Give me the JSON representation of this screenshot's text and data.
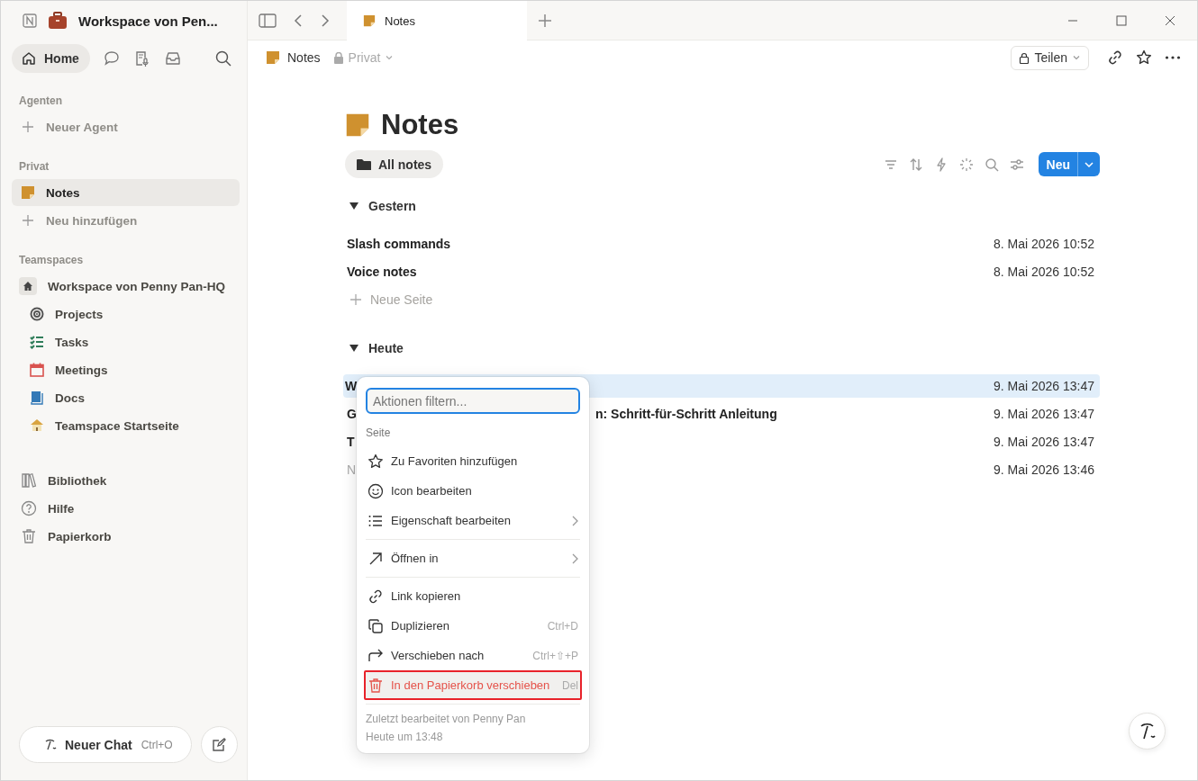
{
  "sidebar": {
    "workspace": "Workspace von Pen...",
    "home": {
      "label": "Home",
      "selected": true
    },
    "agents": {
      "heading": "Agenten",
      "add": "Neuer Agent"
    },
    "private": {
      "heading": "Privat",
      "items": [
        {
          "label": "Notes",
          "selected": true
        }
      ],
      "add": "Neu hinzufügen"
    },
    "teamspaces": {
      "heading": "Teamspaces",
      "workspace": "Workspace von Penny Pan-HQ",
      "items": [
        {
          "label": "Projects",
          "color": "#555555"
        },
        {
          "label": "Tasks",
          "color": "#2f7d5a"
        },
        {
          "label": "Meetings",
          "color": "#d9534f"
        },
        {
          "label": "Docs",
          "color": "#337ab7"
        },
        {
          "label": "Teamspace Startseite",
          "color": "#d9a441"
        }
      ]
    },
    "footer_items": [
      {
        "label": "Bibliothek"
      },
      {
        "label": "Hilfe"
      },
      {
        "label": "Papierkorb"
      }
    ],
    "chat": {
      "label": "Neuer Chat",
      "shortcut": "Ctrl+O"
    }
  },
  "tabs": [
    {
      "label": "Notes",
      "selected": true
    }
  ],
  "breadcrumb": {
    "page": "Notes",
    "privacy": "Privat"
  },
  "share": "Teilen",
  "page": {
    "title": "Notes",
    "view": "All notes",
    "new_button": "Neu",
    "groups": [
      {
        "title": "Gestern",
        "expanded": true,
        "rows": [
          {
            "title": "Slash commands",
            "date": "8. Mai 2026 10:52",
            "selected": false,
            "muted": false
          },
          {
            "title": "Voice notes",
            "date": "8. Mai 2026 10:52",
            "selected": false,
            "muted": false
          }
        ],
        "add": "Neue Seite"
      },
      {
        "title": "Heute",
        "expanded": true,
        "rows": [
          {
            "title": "W",
            "date": "9. Mai 2026 13:47",
            "selected": true,
            "muted": false
          },
          {
            "title": "G",
            "title_after_menu": "n: Schritt-für-Schritt Anleitung",
            "date": "9. Mai 2026 13:47",
            "selected": false,
            "muted": false
          },
          {
            "title": "T",
            "date": "9. Mai 2026 13:47",
            "selected": false,
            "muted": false
          },
          {
            "title": "N",
            "date": "9. Mai 2026 13:46",
            "selected": false,
            "muted": true
          }
        ]
      }
    ]
  },
  "menu": {
    "placeholder": "Aktionen filtern...",
    "heading": "Seite",
    "groups": [
      [
        {
          "label": "Zu Favoriten hinzufügen",
          "kind": "action",
          "submenu": false,
          "selected": false
        },
        {
          "label": "Icon bearbeiten",
          "kind": "action",
          "submenu": false,
          "selected": false
        },
        {
          "label": "Eigenschaft bearbeiten",
          "kind": "action",
          "submenu": true,
          "selected": false
        }
      ],
      [
        {
          "label": "Öffnen in",
          "kind": "action",
          "submenu": true,
          "selected": false
        }
      ],
      [
        {
          "label": "Link kopieren",
          "kind": "action",
          "submenu": false,
          "selected": false
        },
        {
          "label": "Duplizieren",
          "shortcut": "Ctrl+D",
          "kind": "action",
          "submenu": false,
          "selected": false
        },
        {
          "label": "Verschieben nach",
          "shortcut": "Ctrl+⇧+P",
          "kind": "action",
          "submenu": false,
          "selected": false
        },
        {
          "label": "In den Papierkorb verschieben",
          "shortcut": "Del",
          "kind": "destructive",
          "submenu": false,
          "selected": true
        }
      ]
    ],
    "footer": [
      "Zuletzt bearbeitet von Penny Pan",
      "Heute um 13:48"
    ]
  }
}
